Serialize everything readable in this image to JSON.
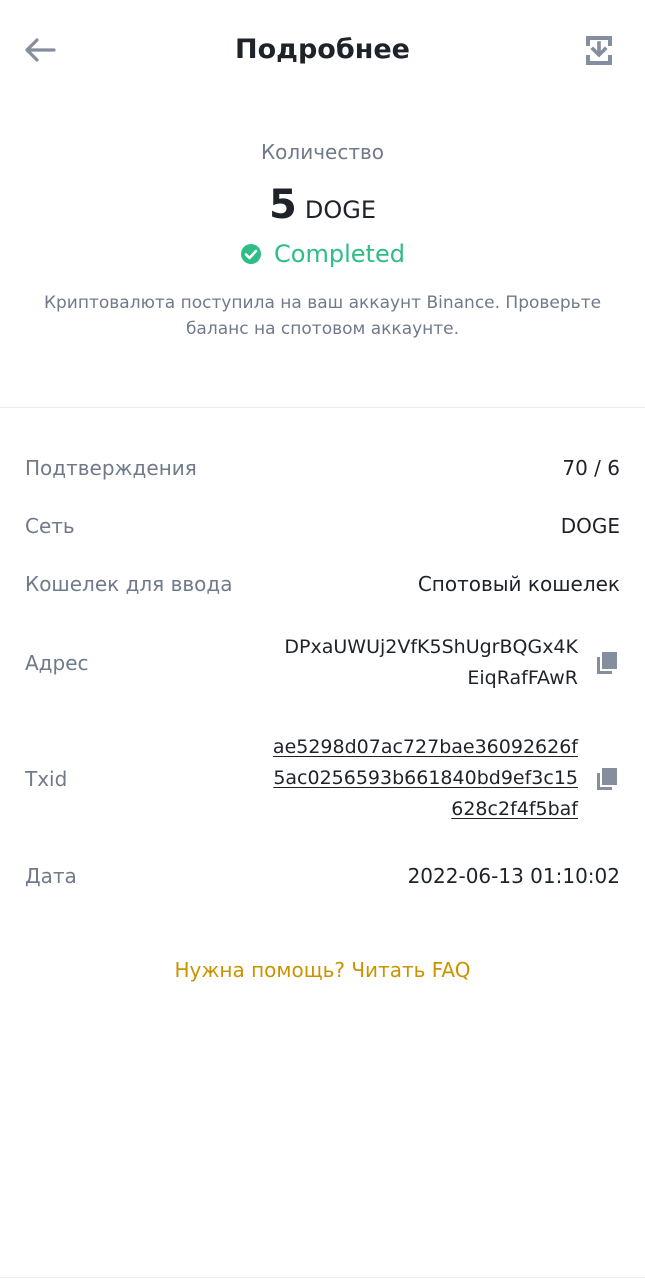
{
  "header": {
    "title": "Подробнее",
    "back_icon": "arrow-left-icon",
    "share_icon": "download-icon"
  },
  "summary": {
    "quantity_label": "Количество",
    "amount": "5",
    "currency": "DOGE",
    "status": "Completed",
    "status_color": "#2ebd85",
    "note": "Криптовалюта поступила на ваш аккаунт Binance. Проверьте баланс на спотовом аккаунте."
  },
  "details": {
    "confirmations": {
      "label": "Подтверждения",
      "value": "70 / 6"
    },
    "network": {
      "label": "Сеть",
      "value": "DOGE"
    },
    "wallet": {
      "label": "Кошелек для ввода",
      "value": "Спотовый кошелек"
    },
    "address": {
      "label": "Адрес",
      "line1": "DPxaUWUj2VfK5ShUgrBQGx4K",
      "line2": "EiqRafFAwR"
    },
    "txid": {
      "label": "Txid",
      "line1": "ae5298d07ac727bae36092626f",
      "line2": "5ac0256593b661840bd9ef3c15",
      "line3": "628c2f4f5baf"
    },
    "date": {
      "label": "Дата",
      "value": "2022-06-13 01:10:02"
    }
  },
  "help_link": "Нужна помощь? Читать FAQ",
  "colors": {
    "accent": "#c99400",
    "muted": "#707a8a",
    "text": "#1e2329"
  }
}
